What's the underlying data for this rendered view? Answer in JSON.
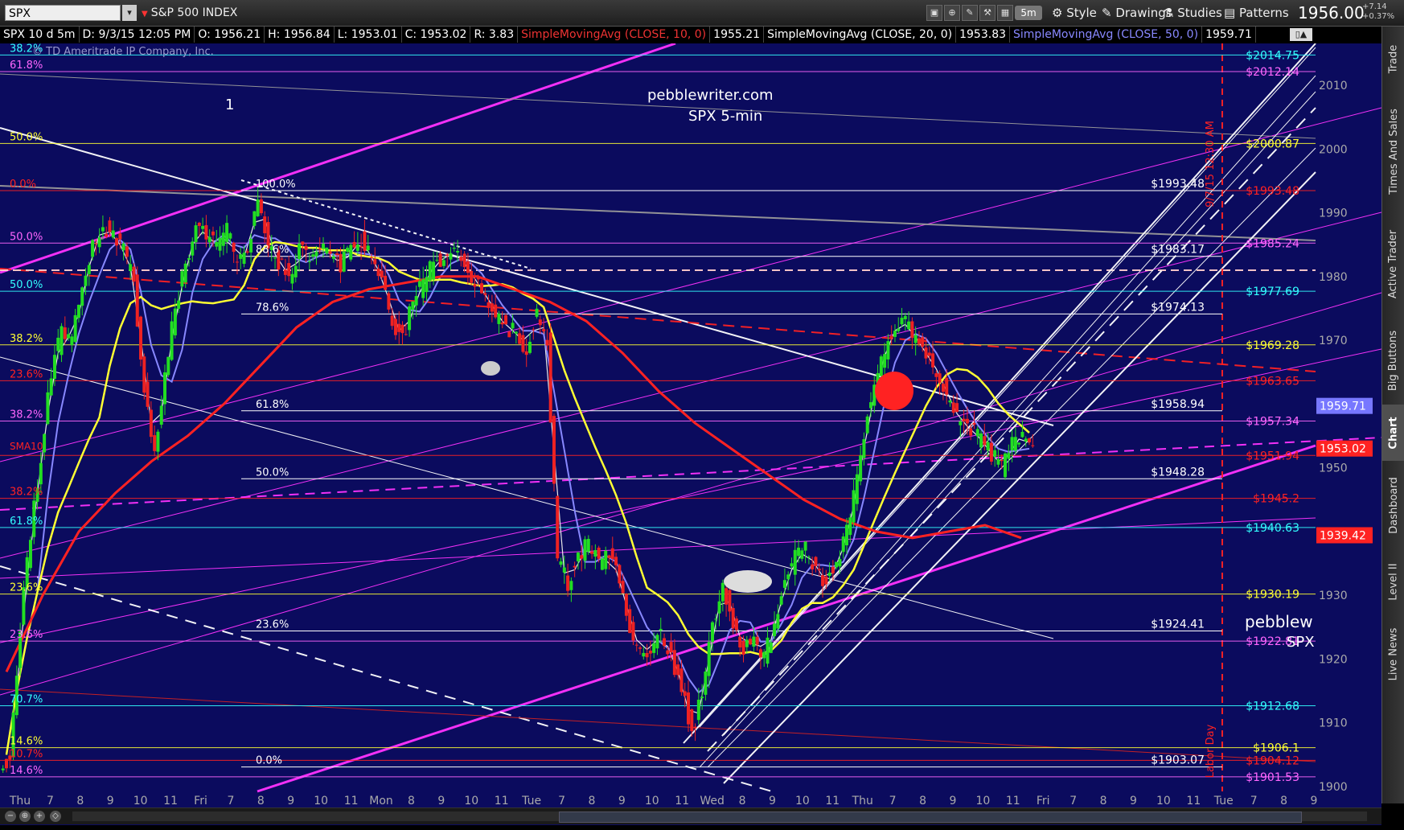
{
  "toolbar": {
    "symbol": "SPX",
    "name": "S&P 500 INDEX",
    "interval": "5m",
    "buttons": [
      "Style",
      "Drawings",
      "Studies",
      "Patterns"
    ],
    "last": "1956.00",
    "change": "+7.14",
    "change_pct": "+0.37%"
  },
  "header": {
    "study_line": "SPX 10 d 5m",
    "date": "D: 9/3/15 12:05 PM",
    "open": "O: 1956.21",
    "high": "H: 1956.84",
    "low": "L: 1953.01",
    "close": "C: 1953.02",
    "range": "R: 3.83",
    "sma10_label": "SimpleMovingAvg (CLOSE, 10, 0)",
    "sma10_value": "1955.21",
    "sma20_label": "SimpleMovingAvg (CLOSE, 20, 0)",
    "sma20_value": "1953.83",
    "sma50_label": "SimpleMovingAvg (CLOSE, 50, 0)",
    "sma50_value": "1959.71"
  },
  "sidebar": [
    "Trade",
    "Times And Sales",
    "Active Trader",
    "Big Buttons",
    "Chart",
    "Dashboard",
    "Level II",
    "Live News"
  ],
  "colors": {
    "chart_bg": "#0b0b5e",
    "sma10": "#e8e8e8",
    "sma20": "#8888ff",
    "sma50": "#ffff33",
    "sma200": "#ff2222",
    "magenta": "#ff33ff",
    "fib_white": "#ffffff",
    "fib_cyan": "#33ffff",
    "fib_yellow": "#ffff33",
    "fib_red": "#ff2222",
    "fib_pink": "#ff66ff"
  },
  "annotations": {
    "watermark": "© TD Ameritrade IP Company, Inc.",
    "site": "pebblewriter.com",
    "subtitle": "SPX 5-min",
    "wave_label": "1",
    "right_cut_1": "pebblew",
    "right_cut_2": "SPX",
    "sma10_tag": "SMA10",
    "vertical_1": "9/7/15 12:30 AM",
    "vertical_2": "Labor Day"
  },
  "chart_data": {
    "type": "candlestick",
    "title": "SPX 5-min",
    "y_range": [
      1900,
      2022
    ],
    "y_ticks": [
      1900,
      1910,
      1920,
      1930,
      1940,
      1950,
      1960,
      1970,
      1980,
      1990,
      2000,
      2010
    ],
    "x_days": [
      "Thu",
      "Fri",
      "Mon",
      "Tue",
      "Wed",
      "Thu",
      "Fri",
      "Tue"
    ],
    "x_tick_labels": [
      {
        "label": "Thu",
        "day": true
      },
      {
        "label": "7"
      },
      {
        "label": "8"
      },
      {
        "label": "9"
      },
      {
        "label": "10"
      },
      {
        "label": "11"
      },
      {
        "label": "Fri",
        "day": true
      },
      {
        "label": "7"
      },
      {
        "label": "8"
      },
      {
        "label": "9"
      },
      {
        "label": "10"
      },
      {
        "label": "11"
      },
      {
        "label": "Mon",
        "day": true
      },
      {
        "label": "8"
      },
      {
        "label": "9"
      },
      {
        "label": "10"
      },
      {
        "label": "11"
      },
      {
        "label": "Tue",
        "day": true
      },
      {
        "label": "7"
      },
      {
        "label": "8"
      },
      {
        "label": "9"
      },
      {
        "label": "10"
      },
      {
        "label": "11"
      },
      {
        "label": "Wed",
        "day": true
      },
      {
        "label": "8"
      },
      {
        "label": "9"
      },
      {
        "label": "10"
      },
      {
        "label": "11"
      },
      {
        "label": "Thu",
        "day": true
      },
      {
        "label": "7"
      },
      {
        "label": "8"
      },
      {
        "label": "9"
      },
      {
        "label": "10"
      },
      {
        "label": "11"
      },
      {
        "label": "Fri",
        "day": true
      },
      {
        "label": "7"
      },
      {
        "label": "8"
      },
      {
        "label": "9"
      },
      {
        "label": "10"
      },
      {
        "label": "11"
      },
      {
        "label": "Tue",
        "day": true
      },
      {
        "label": "7"
      },
      {
        "label": "8"
      },
      {
        "label": "9"
      }
    ],
    "right_price_labels": [
      {
        "text": "$2014.75",
        "price": 2014.75,
        "color": "#33ffff"
      },
      {
        "text": "$2012.14",
        "price": 2012.14,
        "color": "#ff66ff"
      },
      {
        "text": "$2000.87",
        "price": 2000.87,
        "color": "#ffff33"
      },
      {
        "text": "$1993.48",
        "price": 1993.48,
        "color": "#ff2222"
      },
      {
        "text": "$1985.24",
        "price": 1985.24,
        "color": "#ff66ff"
      },
      {
        "text": "$1977.69",
        "price": 1977.69,
        "color": "#33ffff"
      },
      {
        "text": "$1969.28",
        "price": 1969.28,
        "color": "#ffff33"
      },
      {
        "text": "$1963.65",
        "price": 1963.65,
        "color": "#ff2222"
      },
      {
        "text": "$1957.34",
        "price": 1957.34,
        "color": "#ff66ff"
      },
      {
        "text": "$1951.94",
        "price": 1951.94,
        "color": "#ff2222"
      },
      {
        "text": "$1945.2",
        "price": 1945.2,
        "color": "#ff2222"
      },
      {
        "text": "$1940.63",
        "price": 1940.63,
        "color": "#33ffff"
      },
      {
        "text": "$1930.19",
        "price": 1930.19,
        "color": "#ffff33"
      },
      {
        "text": "$1922.81",
        "price": 1922.81,
        "color": "#ff66ff"
      },
      {
        "text": "$1912.68",
        "price": 1912.68,
        "color": "#33ffff"
      },
      {
        "text": "$1906.1",
        "price": 1906.1,
        "color": "#ffff33"
      },
      {
        "text": "$1904.12",
        "price": 1904.12,
        "color": "#ff2222"
      },
      {
        "text": "$1901.53",
        "price": 1901.53,
        "color": "#ff66ff"
      }
    ],
    "mid_price_labels": [
      {
        "text": "$1993.48",
        "price": 1993.48
      },
      {
        "text": "$1983.17",
        "price": 1983.17
      },
      {
        "text": "$1974.13",
        "price": 1974.13
      },
      {
        "text": "$1958.94",
        "price": 1958.94
      },
      {
        "text": "$1948.28",
        "price": 1948.28
      },
      {
        "text": "$1924.41",
        "price": 1924.41
      },
      {
        "text": "$1903.07",
        "price": 1903.07
      }
    ],
    "axis_badges": [
      {
        "text": "1959.71",
        "price": 1959.71,
        "bg": "#7777ff"
      },
      {
        "text": "1953.02",
        "price": 1953.02,
        "bg": "#ff2222"
      },
      {
        "text": "1939.42",
        "price": 1939.42,
        "bg": "#ff2222"
      }
    ],
    "fib_mid_labels": [
      {
        "text": "100.0%",
        "price": 1993.48
      },
      {
        "text": "88.6%",
        "price": 1983.17
      },
      {
        "text": "78.6%",
        "price": 1974.13
      },
      {
        "text": "61.8%",
        "price": 1958.94
      },
      {
        "text": "50.0%",
        "price": 1948.28
      },
      {
        "text": "23.6%",
        "price": 1924.41
      },
      {
        "text": "0.0%",
        "price": 1903.07
      }
    ],
    "fib_left_labels": [
      {
        "text": "38.2%",
        "price": 2014.75,
        "color": "#33ffff"
      },
      {
        "text": "61.8%",
        "price": 2012.14,
        "color": "#ff66ff"
      },
      {
        "text": "50.0%",
        "price": 2000.87,
        "color": "#ffff33"
      },
      {
        "text": "0.0%",
        "price": 1993.48,
        "color": "#ff2222"
      },
      {
        "text": "50.0%",
        "price": 1985.24,
        "color": "#ff66ff"
      },
      {
        "text": "50.0%",
        "price": 1977.69,
        "color": "#33ffff"
      },
      {
        "text": "38.2%",
        "price": 1969.28,
        "color": "#ffff33"
      },
      {
        "text": "23.6%",
        "price": 1963.65,
        "color": "#ff2222"
      },
      {
        "text": "38.2%",
        "price": 1957.34,
        "color": "#ff66ff"
      },
      {
        "text": "38.2%",
        "price": 1945.2,
        "color": "#ff2222"
      },
      {
        "text": "61.8%",
        "price": 1940.63,
        "color": "#33ffff"
      },
      {
        "text": "23.6%",
        "price": 1930.19,
        "color": "#ffff33"
      },
      {
        "text": "23.6%",
        "price": 1922.81,
        "color": "#ff66ff"
      },
      {
        "text": "70.7%",
        "price": 1912.68,
        "color": "#33ffff"
      },
      {
        "text": "14.6%",
        "price": 1906.1,
        "color": "#ffff33"
      },
      {
        "text": "10.7%",
        "price": 1904.12,
        "color": "#ff2222"
      },
      {
        "text": "14.6%",
        "price": 1901.53,
        "color": "#ff66ff"
      }
    ],
    "close_series": [
      1905,
      1925,
      1940,
      1952,
      1965,
      1971,
      1970,
      1978,
      1985,
      1988,
      1986,
      1984,
      1979,
      1962,
      1952,
      1965,
      1975,
      1982,
      1988,
      1986,
      1985,
      1987,
      1982,
      1984,
      1993,
      1985,
      1982,
      1980,
      1984,
      1983,
      1985,
      1983,
      1982,
      1984,
      1986,
      1982,
      1980,
      1973,
      1970,
      1976,
      1979,
      1982,
      1983,
      1984,
      1982,
      1979,
      1977,
      1974,
      1972,
      1971,
      1969,
      1974,
      1970,
      1935,
      1932,
      1936,
      1938,
      1935,
      1936,
      1932,
      1925,
      1921,
      1922,
      1924,
      1920,
      1916,
      1908,
      1915,
      1925,
      1932,
      1926,
      1921,
      1924,
      1920,
      1926,
      1932,
      1936,
      1937,
      1934,
      1932,
      1935,
      1940,
      1948,
      1958,
      1965,
      1970,
      1973,
      1972,
      1969,
      1967,
      1964,
      1960,
      1957,
      1956,
      1954,
      1952,
      1950,
      1954,
      1955,
      1953
    ],
    "sma200_approx": [
      1918,
      1930,
      1940,
      1946,
      1951,
      1955,
      1960,
      1966,
      1972,
      1976,
      1978,
      1979,
      1980,
      1980,
      1978,
      1976,
      1973,
      1968,
      1962,
      1957,
      1953,
      1949,
      1945,
      1942,
      1940,
      1939,
      1940,
      1941,
      1939
    ]
  }
}
